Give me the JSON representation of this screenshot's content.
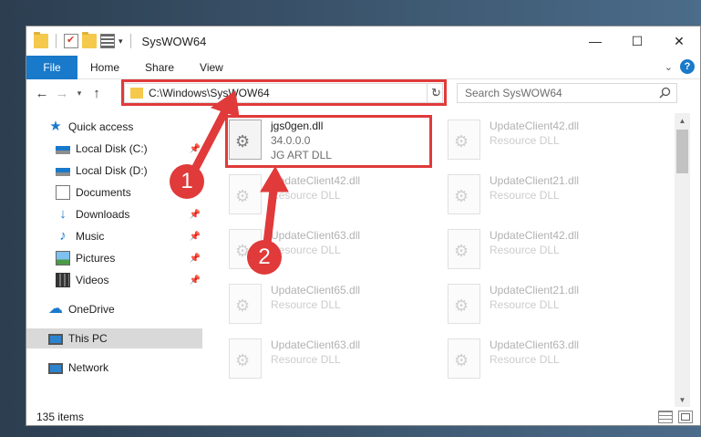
{
  "window": {
    "title": "SysWOW64",
    "controls": {
      "minimize": "—",
      "maximize": "☐",
      "close": "✕"
    }
  },
  "ribbon": {
    "tabs": [
      {
        "label": "File"
      },
      {
        "label": "Home"
      },
      {
        "label": "Share"
      },
      {
        "label": "View"
      }
    ],
    "expand_icon": "chevron-down-icon",
    "help_icon": "help-icon",
    "help_glyph": "?"
  },
  "nav": {
    "address": "C:\\Windows\\SysWOW64",
    "search_placeholder": "Search SysWOW64"
  },
  "sidebar": {
    "items": [
      {
        "label": "Quick access",
        "icon": "star-icon",
        "pinned": false
      },
      {
        "label": "Local Disk (C:)",
        "icon": "drive-icon",
        "pinned": true
      },
      {
        "label": "Local Disk (D:)",
        "icon": "drive-icon",
        "pinned": false
      },
      {
        "label": "Documents",
        "icon": "documents-icon",
        "pinned": true
      },
      {
        "label": "Downloads",
        "icon": "downloads-icon",
        "pinned": true
      },
      {
        "label": "Music",
        "icon": "music-icon",
        "pinned": true
      },
      {
        "label": "Pictures",
        "icon": "pictures-icon",
        "pinned": true
      },
      {
        "label": "Videos",
        "icon": "videos-icon",
        "pinned": true
      },
      {
        "label": "OneDrive",
        "icon": "onedrive-icon",
        "pinned": false
      },
      {
        "label": "This PC",
        "icon": "this-pc-icon",
        "pinned": false,
        "selected": true
      },
      {
        "label": "Network",
        "icon": "network-icon",
        "pinned": false
      }
    ]
  },
  "files": {
    "highlighted": {
      "name": "jgs0gen.dll",
      "version": "34.0.0.0",
      "description": "JG ART DLL"
    },
    "background": [
      {
        "name": "UpdateClient42.dll",
        "description": "Resource DLL"
      },
      {
        "name": "UpdateClient42.dll",
        "description": "Resource DLL"
      },
      {
        "name": "UpdateClient21.dll",
        "description": "Resource DLL"
      },
      {
        "name": "UpdateClient63.dll",
        "description": "Resource DLL"
      },
      {
        "name": "UpdateClient42.dll",
        "description": "Resource DLL"
      },
      {
        "name": "UpdateClient65.dll",
        "description": "Resource DLL"
      },
      {
        "name": "UpdateClient21.dll",
        "description": "Resource DLL"
      },
      {
        "name": "UpdateClient63.dll",
        "description": "Resource DLL"
      },
      {
        "name": "UpdateClient63.dll",
        "description": "Resource DLL"
      }
    ]
  },
  "status": {
    "item_count": "135 items"
  },
  "callouts": {
    "one": "1",
    "two": "2"
  },
  "colors": {
    "accent": "#1979ca",
    "highlight": "#e03a3a"
  }
}
